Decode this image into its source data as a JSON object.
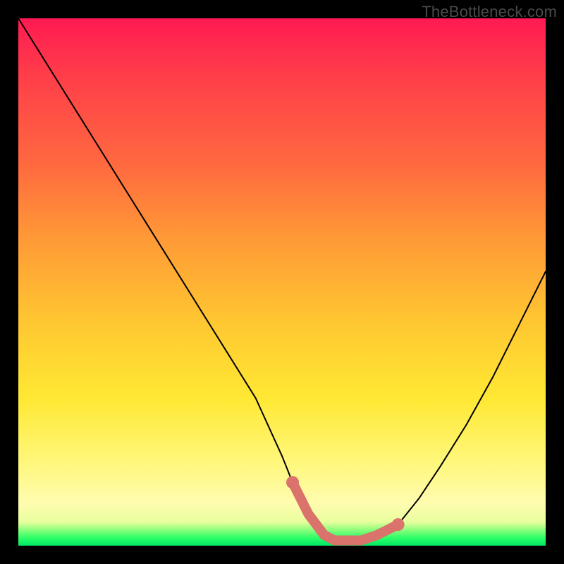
{
  "watermark": "TheBottleneck.com",
  "chart_data": {
    "type": "line",
    "title": "",
    "xlabel": "",
    "ylabel": "",
    "xlim": [
      0,
      100
    ],
    "ylim": [
      0,
      100
    ],
    "grid": false,
    "legend": false,
    "series": [
      {
        "name": "bottleneck-curve",
        "x": [
          0,
          5,
          10,
          15,
          20,
          25,
          30,
          35,
          40,
          45,
          50,
          52,
          55,
          58,
          60,
          63,
          65,
          68,
          72,
          76,
          80,
          85,
          90,
          95,
          100
        ],
        "y": [
          100,
          92,
          84,
          76,
          68,
          60,
          52,
          44,
          36,
          28,
          17,
          12,
          6,
          2,
          1,
          1,
          1,
          2,
          4,
          9,
          15,
          23,
          32,
          42,
          52
        ]
      }
    ],
    "highlight": {
      "name": "bottleneck-region",
      "x": [
        52,
        55,
        58,
        60,
        63,
        65,
        68,
        72
      ],
      "y": [
        12,
        6,
        2,
        1,
        1,
        1,
        2,
        4
      ]
    },
    "gradient_stops": [
      {
        "pos": 0.0,
        "color": "#ff1a52"
      },
      {
        "pos": 0.42,
        "color": "#ff9a36"
      },
      {
        "pos": 0.72,
        "color": "#ffe833"
      },
      {
        "pos": 0.95,
        "color": "#e8ff9e"
      },
      {
        "pos": 1.0,
        "color": "#00e765"
      }
    ]
  }
}
